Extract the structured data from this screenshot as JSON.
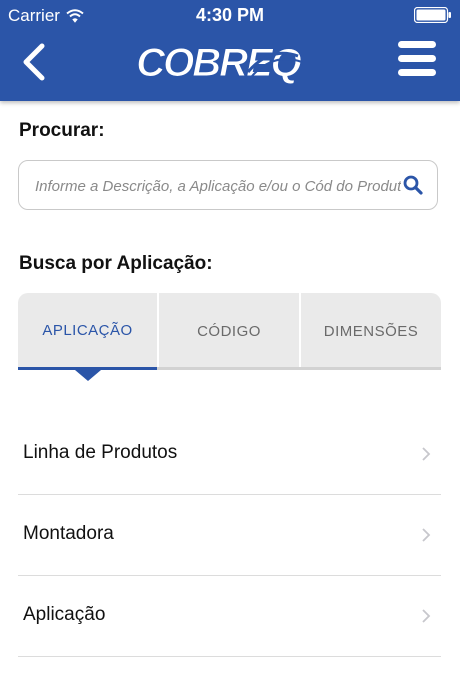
{
  "status_bar": {
    "carrier": "Carrier",
    "time": "4:30 PM"
  },
  "header": {
    "logo_text": "COBREQ",
    "brand_color": "#2b55a8"
  },
  "search": {
    "label": "Procurar:",
    "placeholder": "Informe a Descrição, a Aplicação e/ou o Cód do Produto"
  },
  "section": {
    "label": "Busca por Aplicação:",
    "tabs": [
      {
        "label": "APLICAÇÃO",
        "active": true
      },
      {
        "label": "CÓDIGO",
        "active": false
      },
      {
        "label": "DIMENSÕES",
        "active": false
      }
    ]
  },
  "list": {
    "items": [
      {
        "label": "Linha de Produtos"
      },
      {
        "label": "Montadora"
      },
      {
        "label": "Aplicação"
      }
    ]
  }
}
